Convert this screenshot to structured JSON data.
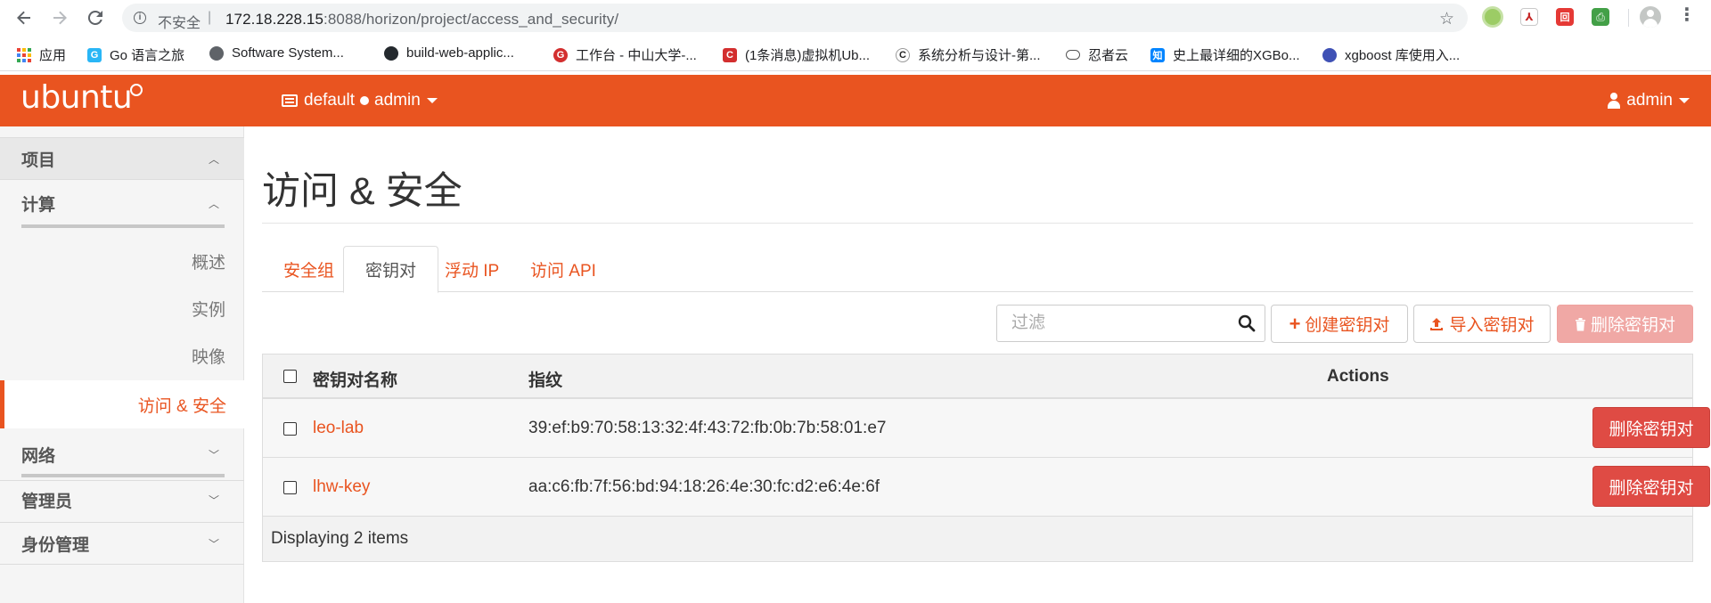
{
  "browser": {
    "insecure_label": "不安全",
    "url_host": "172.18.228.15",
    "url_rest": ":8088/horizon/project/access_and_security/",
    "bookmarks": [
      {
        "label": "应用",
        "icon": "apps-icon"
      },
      {
        "label": "Go 语言之旅",
        "icon": "go-gopher-icon"
      },
      {
        "label": "Software System...",
        "icon": "globe-icon"
      },
      {
        "label": "build-web-applic...",
        "icon": "github-icon"
      },
      {
        "label": "工作台 - 中山大学-...",
        "icon": "sysu-icon"
      },
      {
        "label": "(1条消息)虚拟机Ub...",
        "icon": "csdn-icon"
      },
      {
        "label": "系统分析与设计-第...",
        "icon": "c-icon"
      },
      {
        "label": "忍者云",
        "icon": "cloud-icon"
      },
      {
        "label": "史上最详细的XGBo...",
        "icon": "zhihu-icon"
      },
      {
        "label": "xgboost 库使用入...",
        "icon": "bookmark-icon"
      }
    ]
  },
  "header": {
    "logo": "ubuntu",
    "project": "default",
    "project_user": "admin",
    "user": "admin"
  },
  "sidebar": {
    "sections": {
      "project": "项目",
      "compute": "计算",
      "network": "网络",
      "admin": "管理员",
      "identity": "身份管理"
    },
    "compute_items": [
      "概述",
      "实例",
      "映像",
      "访问 & 安全"
    ]
  },
  "main": {
    "title": "访问 & 安全",
    "tabs": [
      "安全组",
      "密钥对",
      "浮动 IP",
      "访问 API"
    ],
    "filter_placeholder": "过滤",
    "buttons": {
      "create": "创建密钥对",
      "import": "导入密钥对",
      "delete": "删除密钥对"
    },
    "table": {
      "headers": [
        "密钥对名称",
        "指纹",
        "Actions"
      ],
      "rows": [
        {
          "name": "leo-lab",
          "fingerprint": "39:ef:b9:70:58:13:32:4f:43:72:fb:0b:7b:58:01:e7",
          "action": "删除密钥对"
        },
        {
          "name": "lhw-key",
          "fingerprint": "aa:c6:fb:7f:56:bd:94:18:26:4e:30:fc:d2:e6:4e:6f",
          "action": "删除密钥对"
        }
      ],
      "footer": "Displaying 2 items"
    }
  },
  "colors": {
    "brand": "#e95420",
    "danger": "#df4b44",
    "danger_disabled": "#f0a8a5"
  }
}
